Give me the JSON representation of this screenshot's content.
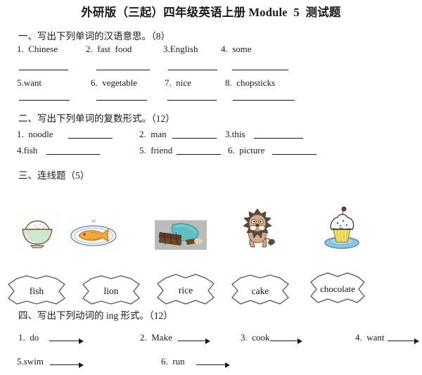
{
  "document": {
    "title": "外研版（三起）四年级英语上册 Module  5  测试题"
  },
  "sections": [
    {
      "heading": "一、写出下列单词的汉语意思。（8）",
      "rows": [
        {
          "items": [
            "1.  Chinese",
            "2.  fast  food",
            "3.English",
            "4.  some"
          ]
        },
        {
          "items": [
            "5.want",
            "6.  vegetable",
            "7.  nice",
            "8.  chopsticks"
          ]
        }
      ]
    },
    {
      "heading": "二、写出下列单词的复数形式。（12）",
      "rows": [
        {
          "items": [
            "1.  noodle",
            "2.  man",
            "3.this"
          ]
        },
        {
          "items": [
            "4.fish",
            "5.  friend",
            "6.  picture"
          ]
        }
      ]
    },
    {
      "heading": "三、连线题（5）",
      "pictures": [
        {
          "name": "rice-bowl-image",
          "alt": "bowl of rice"
        },
        {
          "name": "fish-plate-image",
          "alt": "fish on a plate"
        },
        {
          "name": "chocolate-bar-image",
          "alt": "chocolate bar"
        },
        {
          "name": "lion-image",
          "alt": "lion"
        },
        {
          "name": "cupcake-image",
          "alt": "cupcake on a plate"
        }
      ],
      "words": [
        "fish",
        "lion",
        "rice",
        "cake",
        "chocolate"
      ]
    },
    {
      "heading": "四、写出下列动词的 ing 形式。（12）",
      "rows": [
        {
          "items": [
            "1.  do",
            "2.  Make",
            "3.  cook",
            "4.  want"
          ]
        },
        {
          "items": [
            "5.swim",
            "6.  run"
          ]
        }
      ]
    }
  ],
  "colors": {
    "ink": "#1a1a1a",
    "bowl_green": "#cfe7d2",
    "fish_orange": "#f3a83a",
    "chocolate_teal": "#5fc0c3",
    "lion_mane": "#5c4a3c",
    "lion_body": "#d8aa8c",
    "plate_blue": "#8fc5e8",
    "cupcake_yellow": "#f2e26a"
  }
}
